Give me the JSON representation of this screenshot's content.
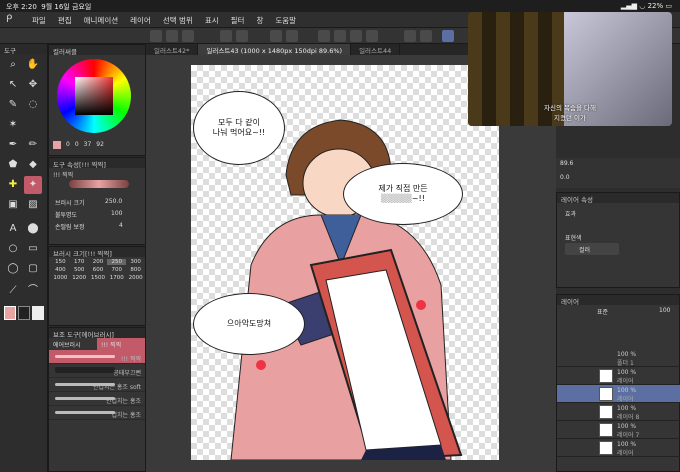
{
  "status": {
    "time": "오후 2:20",
    "date": "9월 16일 금요일",
    "battery": "22%"
  },
  "menu": {
    "items": [
      "파일",
      "편집",
      "애니메이션",
      "레이어",
      "선택 범위",
      "표시",
      "필터",
      "창",
      "도움말"
    ]
  },
  "tabs": [
    "일러스트42*",
    "일러스트43 (1000 x 1480px 150dpi 89.6%)",
    "일러스트44"
  ],
  "tool_panel": {
    "title": "도구"
  },
  "color_panel": {
    "title": "컬러써클",
    "values": [
      "0",
      "0",
      "37",
      "92"
    ]
  },
  "tool_props": {
    "title": "도구 속성[!!! 찍찍]",
    "brush_name": "!!! 찍찍",
    "size_label": "브러시 크기",
    "size_value": "250.0",
    "opacity_label": "불투명도",
    "opacity_value": "100",
    "stabilize_label": "손떨림 보정",
    "stabilize_value": "4"
  },
  "brush_size": {
    "title": "브러시 크기[!!! 찍찍]",
    "sizes": [
      "150",
      "170",
      "200",
      "250",
      "300",
      "400",
      "500",
      "600",
      "700",
      "800",
      "1000",
      "1200",
      "1500",
      "1700",
      "2000"
    ]
  },
  "sub_tool": {
    "title": "보조 도구[에어브러시]",
    "tab1": "에어브러시",
    "tab2": "!!! 찍찍",
    "brushes": [
      "!!! 찍찍",
      "공태부끄뻔",
      "안겹치는 홍조 soft",
      "안겹치는 홍조",
      "겹치는 홍조"
    ]
  },
  "bubbles": {
    "b1_line1": "모두 다 같이",
    "b1_line2": "나눠 먹어요~!!",
    "b2_line1": "제가 직접 만든",
    "b2_line2": "~!!",
    "b3": "으아악도망쳐"
  },
  "video": {
    "caption_line1": "자신의 목숨을 다해",
    "caption_line2": "지켰던 이가"
  },
  "nav": {
    "zoom": "89.6",
    "angle": "0.0"
  },
  "layer_props": {
    "title": "레이어 속성",
    "effect": "효과",
    "expression": "표현색",
    "color": "컬러"
  },
  "layer_panel": {
    "title": "레이어",
    "blend": "표준",
    "opacity": "100"
  },
  "layers": [
    {
      "pct": "100 %",
      "name": "폴더 1"
    },
    {
      "pct": "100 %",
      "name": "레이어"
    },
    {
      "pct": "100 %",
      "name": "레이어"
    },
    {
      "pct": "100 %",
      "name": "레이어 8"
    },
    {
      "pct": "100 %",
      "name": "레이어 7"
    },
    {
      "pct": "100 %",
      "name": "레이어"
    }
  ],
  "colors": {
    "accent": "#c35a6a",
    "bg": "#2b2b2b",
    "layer_sel": "#5b6fa3"
  }
}
